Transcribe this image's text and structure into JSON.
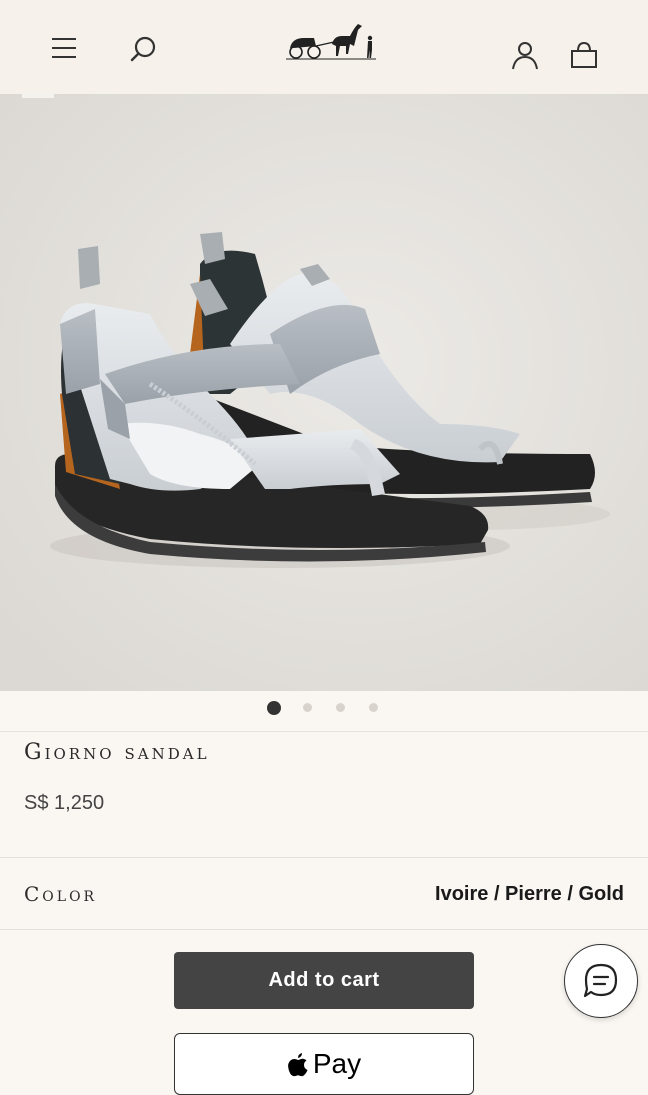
{
  "header": {
    "menu_icon": "hamburger-menu-icon",
    "search_icon": "search-icon",
    "logo": "hermes-carriage-logo",
    "account_icon": "account-icon",
    "bag_icon": "shopping-bag-icon"
  },
  "gallery": {
    "image": "sandal-product-photo",
    "total_slides": 4,
    "active_slide": 1
  },
  "product": {
    "name": "Giorno sandal",
    "price": "S$ 1,250"
  },
  "color": {
    "label": "Color",
    "value": "Ivoire / Pierre / Gold"
  },
  "actions": {
    "add_to_cart": "Add to cart",
    "apple_pay": "Pay"
  },
  "chat": {
    "icon": "chat-icon"
  },
  "colors": {
    "background": "#faf7f2",
    "header": "#f6f1ea",
    "hero": "#e4e2de",
    "cart_button": "#444444",
    "dot_active": "#333333",
    "dot_inactive": "#d8d3cc"
  }
}
